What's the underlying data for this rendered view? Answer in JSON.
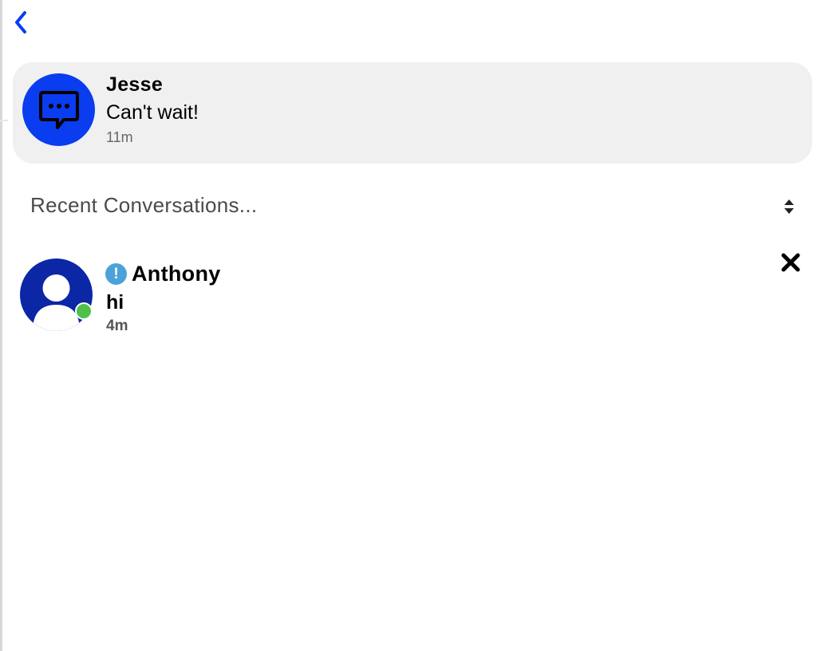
{
  "colors": {
    "accent": "#0a3cf0",
    "avatar_blue": "#0b27a5",
    "card_bg": "#f0f0f0",
    "online": "#4fc14a",
    "alert": "#4aa3d8"
  },
  "nav": {
    "back_icon": "chevron-left-icon"
  },
  "notification": {
    "icon": "chat-bubble-icon",
    "name": "Jesse",
    "message": "Can't wait!",
    "time": "11m"
  },
  "recent": {
    "header": "Recent Conversations...",
    "sort_icon": "sort-icon",
    "items": [
      {
        "name": "Anthony",
        "message": "hi",
        "time": "4m",
        "status": "online",
        "alert_icon": "exclamation-icon",
        "close_icon": "close-icon"
      }
    ]
  }
}
